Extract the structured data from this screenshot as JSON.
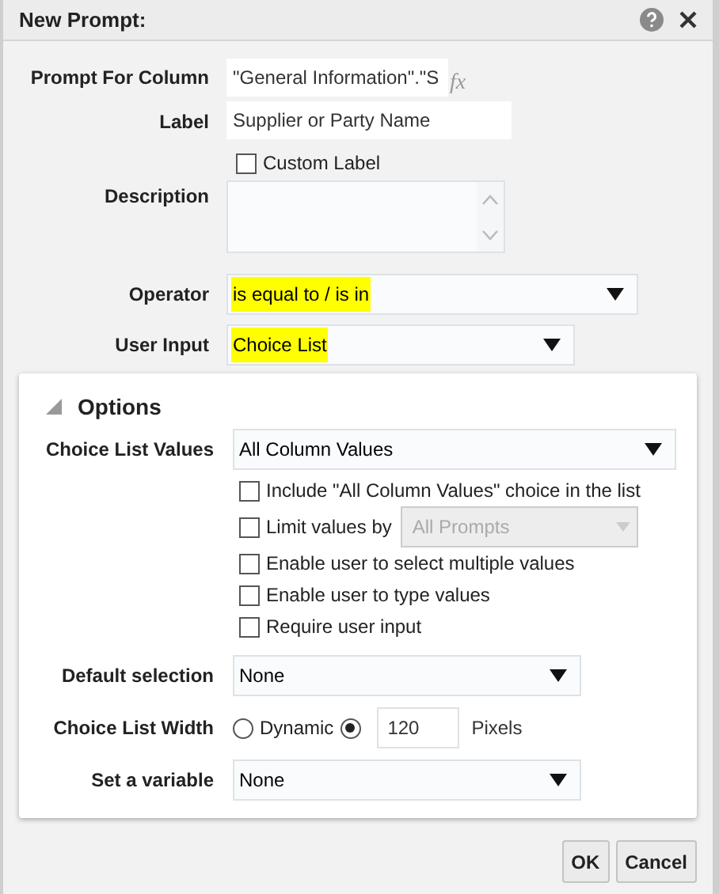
{
  "dialog": {
    "title": "New Prompt:"
  },
  "prompt_for_column": {
    "label": "Prompt For Column",
    "value": "\"General Information\".\"S",
    "formula_button": "fx"
  },
  "label_field": {
    "label": "Label",
    "value": "Supplier or Party Name"
  },
  "custom_label": {
    "label": "Custom Label",
    "checked": false
  },
  "description": {
    "label": "Description"
  },
  "operator": {
    "label": "Operator",
    "value": "is equal to / is in",
    "highlighted": true
  },
  "user_input": {
    "label": "User Input",
    "value": "Choice List",
    "highlighted": true
  },
  "options": {
    "title": "Options",
    "expanded": true,
    "choice_list_values": {
      "label": "Choice List Values",
      "value": "All Column Values"
    },
    "checkboxes": [
      {
        "label": "Include \"All Column Values\" choice in the list",
        "checked": false
      },
      {
        "label": "Limit values by",
        "checked": false,
        "select": {
          "value": "All Prompts",
          "disabled": true
        }
      },
      {
        "label": "Enable user to select multiple values",
        "checked": false
      },
      {
        "label": "Enable user to type values",
        "checked": false
      },
      {
        "label": "Require user input",
        "checked": false
      }
    ],
    "default_selection": {
      "label": "Default selection",
      "value": "None"
    },
    "choice_list_width": {
      "label": "Choice List Width",
      "dynamic": {
        "label": "Dynamic",
        "selected": false
      },
      "fixed": {
        "selected": true,
        "value": "120",
        "unit": "Pixels"
      }
    },
    "set_variable": {
      "label": "Set a variable",
      "value": "None"
    }
  },
  "buttons": [
    {
      "label": "OK"
    },
    {
      "label": "Cancel"
    }
  ]
}
